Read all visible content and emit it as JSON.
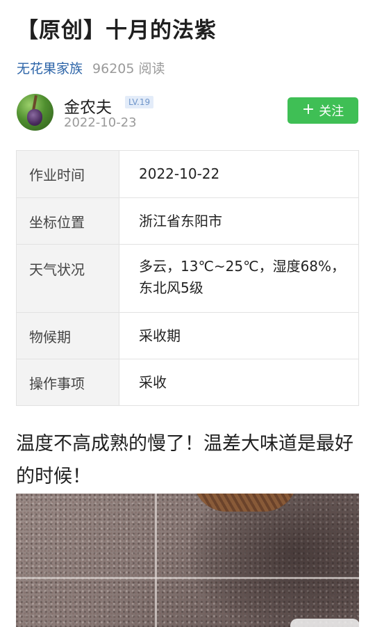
{
  "article": {
    "title": "【原创】十月的法紫",
    "group": "无花果家族",
    "read_count": "96205 阅读"
  },
  "author": {
    "name": "金农夫",
    "level": "LV.19",
    "date": "2022-10-23",
    "follow_label": "关注",
    "follow_icon": "+"
  },
  "info_table": {
    "rows": [
      {
        "key": "作业时间",
        "value": "2022-10-22"
      },
      {
        "key": "坐标位置",
        "value": "浙江省东阳市"
      },
      {
        "key": "天气状况",
        "value": "多云，13℃~25℃，湿度68%，东北风5级"
      },
      {
        "key": "物候期",
        "value": "采收期"
      },
      {
        "key": "操作事项",
        "value": "采收"
      }
    ]
  },
  "body": {
    "text": "温度不高成熟的慢了！温差大味道是最好的时候！"
  },
  "colors": {
    "link": "#2c64a8",
    "follow_button": "#3fbf55",
    "muted": "#9a9a9a"
  }
}
